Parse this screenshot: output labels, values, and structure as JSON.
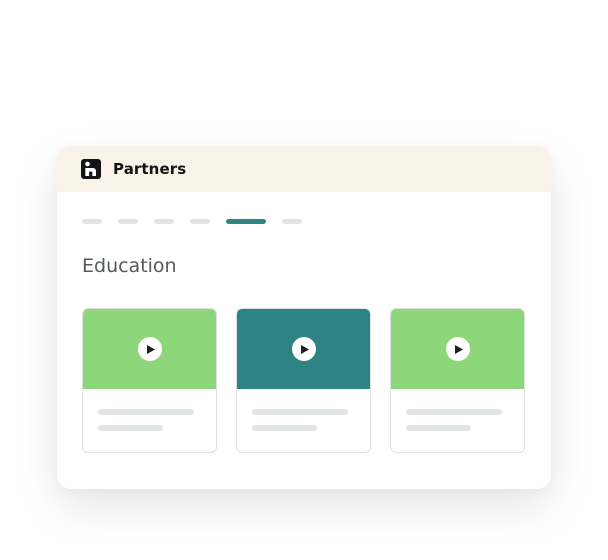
{
  "header": {
    "brand_name": "Partners",
    "logo_icon": "partners-logo-icon"
  },
  "progress": {
    "total_steps": 6,
    "current_step": 5
  },
  "section": {
    "title": "Education"
  },
  "tiles": [
    {
      "media_color": "#8dd67a",
      "icon": "play-icon"
    },
    {
      "media_color": "#2e8484",
      "icon": "play-icon"
    },
    {
      "media_color": "#8dd67a",
      "icon": "play-icon"
    }
  ],
  "colors": {
    "header_bg": "#f9f2e9",
    "accent": "#2e8484",
    "green": "#8dd67a",
    "placeholder": "#e1e6e4"
  }
}
